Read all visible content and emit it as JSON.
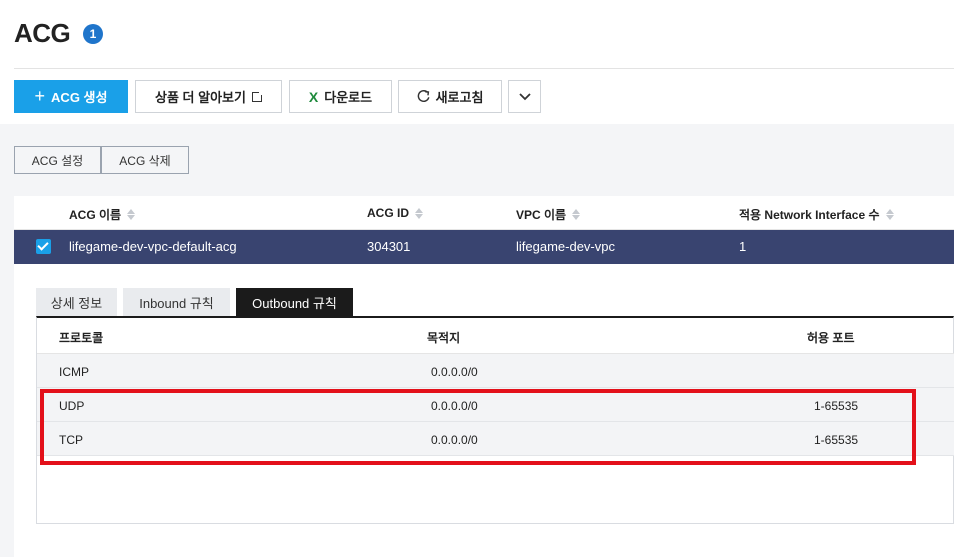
{
  "header": {
    "title": "ACG",
    "badge": "1"
  },
  "toolbar": {
    "create_label": "ACG 생성",
    "info_label": "상품 더 알아보기",
    "download_label": "다운로드",
    "refresh_label": "새로고침"
  },
  "actions": {
    "settings_label": "ACG 설정",
    "delete_label": "ACG 삭제"
  },
  "table": {
    "columns": [
      "ACG 이름",
      "ACG ID",
      "VPC 이름",
      "적용 Network Interface 수"
    ],
    "rows": [
      {
        "name": "lifegame-dev-vpc-default-acg",
        "id": "304301",
        "vpc": "lifegame-dev-vpc",
        "ni_count": "1"
      }
    ]
  },
  "tabs": [
    "상세 정보",
    "Inbound 규칙",
    "Outbound 규칙"
  ],
  "active_tab": "Outbound 규칙",
  "rules": {
    "columns": [
      "프로토콜",
      "목적지",
      "허용 포트"
    ],
    "rows": [
      {
        "protocol": "ICMP",
        "destination": "0.0.0.0/0",
        "port": ""
      },
      {
        "protocol": "UDP",
        "destination": "0.0.0.0/0",
        "port": "1-65535"
      },
      {
        "protocol": "TCP",
        "destination": "0.0.0.0/0",
        "port": "1-65535"
      }
    ]
  },
  "colors": {
    "primary": "#1aa0e8",
    "selected_row": "#394470",
    "active_tab": "#1b1b1b",
    "badge": "#1f75cb",
    "highlight": "#e3101a"
  }
}
